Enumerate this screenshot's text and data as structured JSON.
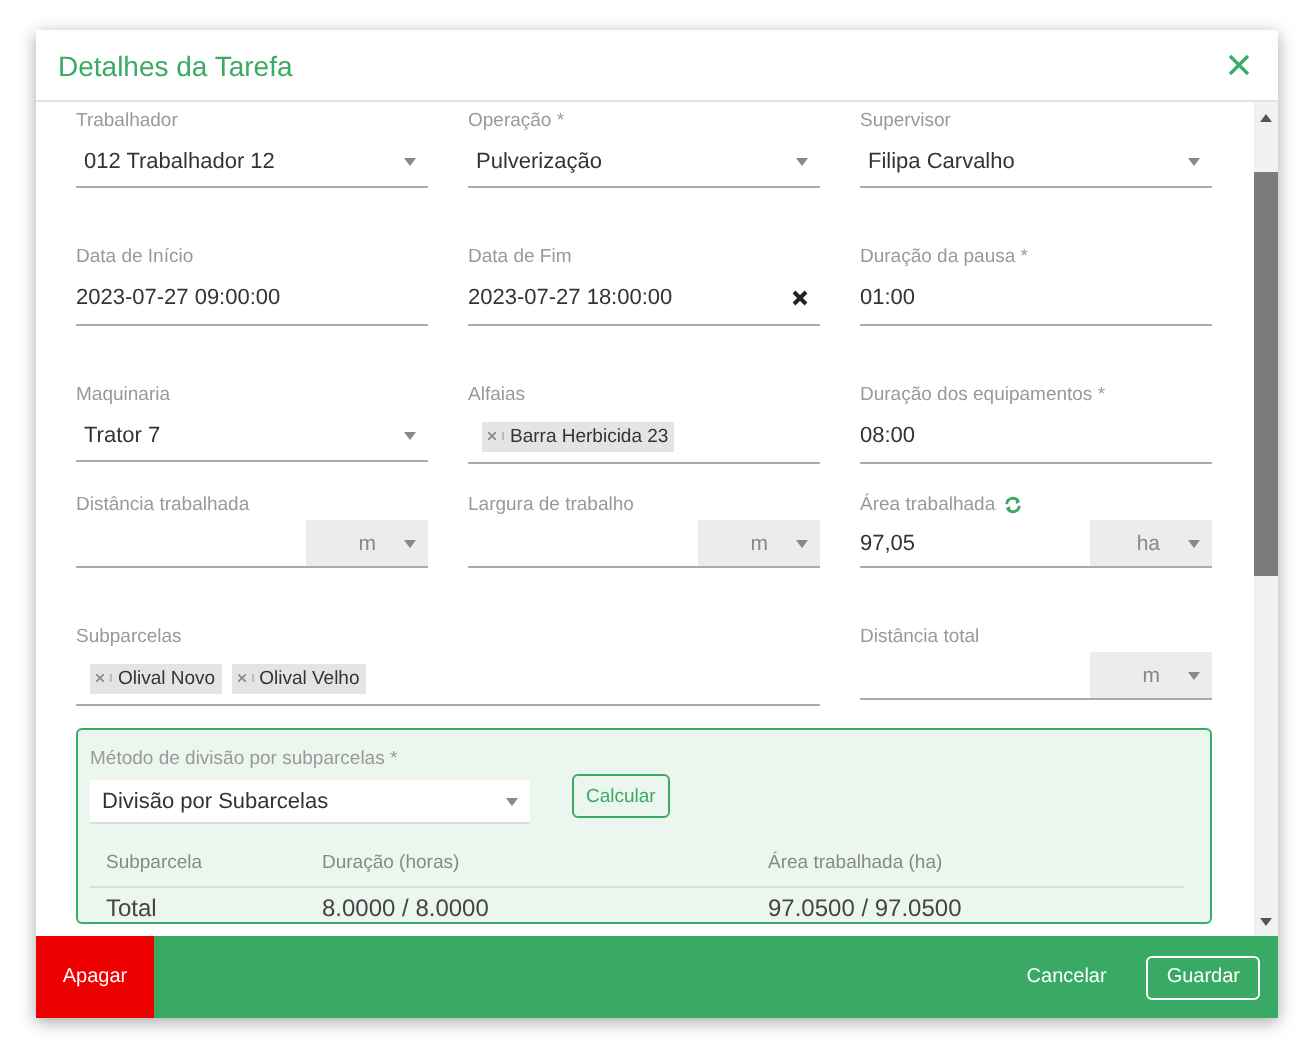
{
  "dialog": {
    "title": "Detalhes da Tarefa"
  },
  "rows": [
    [
      {
        "kind": "select",
        "label": "Trabalhador",
        "value": "012 Trabalhador 12"
      },
      {
        "kind": "select",
        "label": "Operação *",
        "value": "Pulverização"
      },
      {
        "kind": "select",
        "label": "Supervisor",
        "value": "Filipa Carvalho"
      }
    ],
    [
      {
        "kind": "text",
        "label": "Data de Início",
        "value": "2023-07-27 09:00:00"
      },
      {
        "kind": "clearable",
        "label": "Data de Fim",
        "value": "2023-07-27 18:00:00"
      },
      {
        "kind": "text",
        "label": "Duração da pausa *",
        "value": "01:00"
      }
    ],
    [
      {
        "kind": "select",
        "label": "Maquinaria",
        "value": "Trator 7"
      },
      {
        "kind": "chips",
        "label": "Alfaias",
        "chips": [
          "Barra Herbicida 23"
        ]
      },
      {
        "kind": "text",
        "label": "Duração dos equipamentos *",
        "value": "08:00"
      }
    ],
    [
      {
        "kind": "unit",
        "label": "Distância trabalhada",
        "unit": "m"
      },
      {
        "kind": "unit",
        "label": "Largura de trabalho",
        "unit": "m"
      },
      {
        "kind": "unit",
        "label": "Área trabalhada",
        "value": "97,05",
        "unit": "ha",
        "recalculate": true
      }
    ],
    [
      {
        "kind": "chips",
        "label": "Subparcelas",
        "chips": [
          "Olival Novo",
          "Olival Velho"
        ]
      },
      {
        "kind": "unit",
        "label": "Distância total",
        "unit": "m"
      }
    ]
  ],
  "division": {
    "label": "Método de divisão por subparcelas *",
    "value": "Divisão por Subarcelas",
    "button": "Calcular",
    "table": {
      "columns": [
        "Subparcela",
        "Duração (horas)",
        "Área trabalhada (ha)"
      ],
      "rows": [
        {
          "cells": [
            "Total",
            "8.0000 / 8.0000",
            "97.0500 / 97.0500"
          ]
        }
      ]
    }
  },
  "footer": {
    "delete": "Apagar",
    "cancel": "Cancelar",
    "save": "Guardar"
  }
}
